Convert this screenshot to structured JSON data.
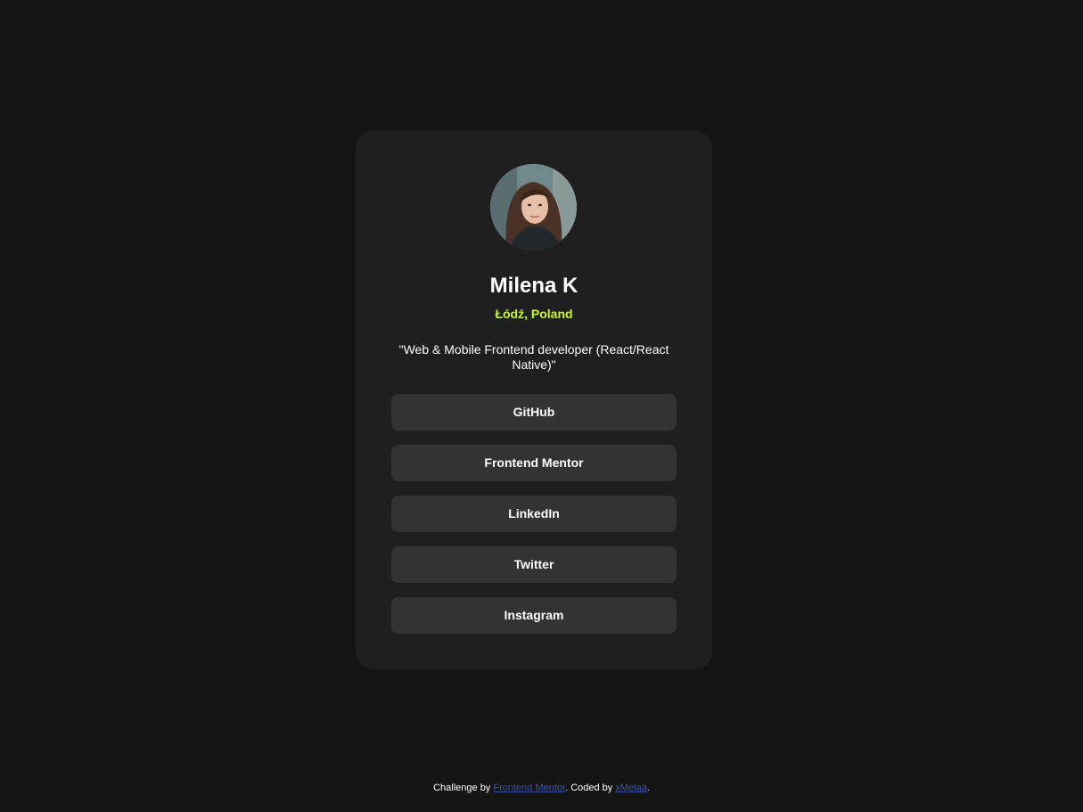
{
  "profile": {
    "avatar_alt": "Milena K",
    "name": "Milena K",
    "location": "Łódź, Poland",
    "bio": "\"Web & Mobile Frontend developer (React/React Native)\""
  },
  "links": [
    {
      "label": "GitHub"
    },
    {
      "label": "Frontend Mentor"
    },
    {
      "label": "LinkedIn"
    },
    {
      "label": "Twitter"
    },
    {
      "label": "Instagram"
    }
  ],
  "attribution": {
    "prefix": "Challenge by ",
    "challenge_link": "Frontend Mentor",
    "middle": ". Coded by ",
    "author_link": "xMelaa",
    "suffix": "."
  },
  "colors": {
    "background": "#141414",
    "card": "#1f1f1f",
    "button": "#333333",
    "accent": "#c5f82a",
    "link": "#3e52a3"
  }
}
